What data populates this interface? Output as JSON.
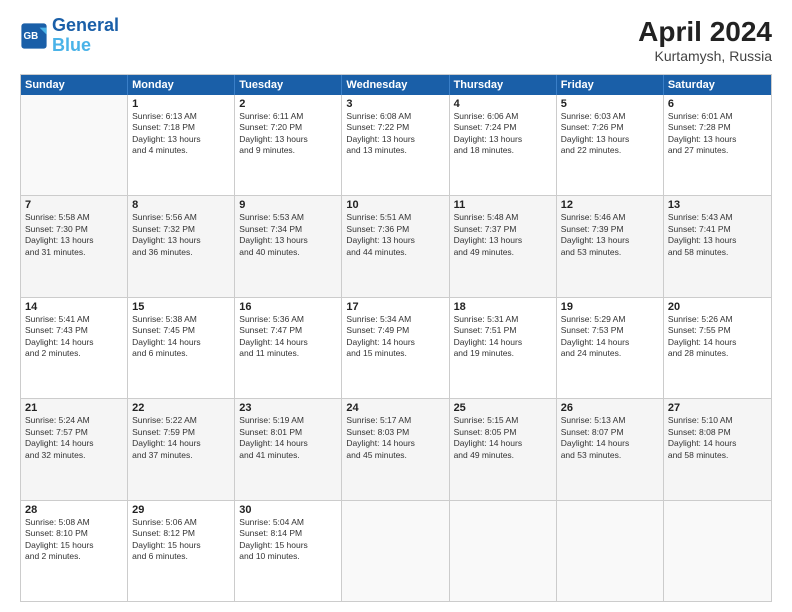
{
  "header": {
    "logo_general": "General",
    "logo_blue": "Blue",
    "month_year": "April 2024",
    "location": "Kurtamysh, Russia"
  },
  "weekdays": [
    "Sunday",
    "Monday",
    "Tuesday",
    "Wednesday",
    "Thursday",
    "Friday",
    "Saturday"
  ],
  "rows": [
    {
      "shade": false,
      "cells": [
        {
          "day": "",
          "lines": []
        },
        {
          "day": "1",
          "lines": [
            "Sunrise: 6:13 AM",
            "Sunset: 7:18 PM",
            "Daylight: 13 hours",
            "and 4 minutes."
          ]
        },
        {
          "day": "2",
          "lines": [
            "Sunrise: 6:11 AM",
            "Sunset: 7:20 PM",
            "Daylight: 13 hours",
            "and 9 minutes."
          ]
        },
        {
          "day": "3",
          "lines": [
            "Sunrise: 6:08 AM",
            "Sunset: 7:22 PM",
            "Daylight: 13 hours",
            "and 13 minutes."
          ]
        },
        {
          "day": "4",
          "lines": [
            "Sunrise: 6:06 AM",
            "Sunset: 7:24 PM",
            "Daylight: 13 hours",
            "and 18 minutes."
          ]
        },
        {
          "day": "5",
          "lines": [
            "Sunrise: 6:03 AM",
            "Sunset: 7:26 PM",
            "Daylight: 13 hours",
            "and 22 minutes."
          ]
        },
        {
          "day": "6",
          "lines": [
            "Sunrise: 6:01 AM",
            "Sunset: 7:28 PM",
            "Daylight: 13 hours",
            "and 27 minutes."
          ]
        }
      ]
    },
    {
      "shade": true,
      "cells": [
        {
          "day": "7",
          "lines": [
            "Sunrise: 5:58 AM",
            "Sunset: 7:30 PM",
            "Daylight: 13 hours",
            "and 31 minutes."
          ]
        },
        {
          "day": "8",
          "lines": [
            "Sunrise: 5:56 AM",
            "Sunset: 7:32 PM",
            "Daylight: 13 hours",
            "and 36 minutes."
          ]
        },
        {
          "day": "9",
          "lines": [
            "Sunrise: 5:53 AM",
            "Sunset: 7:34 PM",
            "Daylight: 13 hours",
            "and 40 minutes."
          ]
        },
        {
          "day": "10",
          "lines": [
            "Sunrise: 5:51 AM",
            "Sunset: 7:36 PM",
            "Daylight: 13 hours",
            "and 44 minutes."
          ]
        },
        {
          "day": "11",
          "lines": [
            "Sunrise: 5:48 AM",
            "Sunset: 7:37 PM",
            "Daylight: 13 hours",
            "and 49 minutes."
          ]
        },
        {
          "day": "12",
          "lines": [
            "Sunrise: 5:46 AM",
            "Sunset: 7:39 PM",
            "Daylight: 13 hours",
            "and 53 minutes."
          ]
        },
        {
          "day": "13",
          "lines": [
            "Sunrise: 5:43 AM",
            "Sunset: 7:41 PM",
            "Daylight: 13 hours",
            "and 58 minutes."
          ]
        }
      ]
    },
    {
      "shade": false,
      "cells": [
        {
          "day": "14",
          "lines": [
            "Sunrise: 5:41 AM",
            "Sunset: 7:43 PM",
            "Daylight: 14 hours",
            "and 2 minutes."
          ]
        },
        {
          "day": "15",
          "lines": [
            "Sunrise: 5:38 AM",
            "Sunset: 7:45 PM",
            "Daylight: 14 hours",
            "and 6 minutes."
          ]
        },
        {
          "day": "16",
          "lines": [
            "Sunrise: 5:36 AM",
            "Sunset: 7:47 PM",
            "Daylight: 14 hours",
            "and 11 minutes."
          ]
        },
        {
          "day": "17",
          "lines": [
            "Sunrise: 5:34 AM",
            "Sunset: 7:49 PM",
            "Daylight: 14 hours",
            "and 15 minutes."
          ]
        },
        {
          "day": "18",
          "lines": [
            "Sunrise: 5:31 AM",
            "Sunset: 7:51 PM",
            "Daylight: 14 hours",
            "and 19 minutes."
          ]
        },
        {
          "day": "19",
          "lines": [
            "Sunrise: 5:29 AM",
            "Sunset: 7:53 PM",
            "Daylight: 14 hours",
            "and 24 minutes."
          ]
        },
        {
          "day": "20",
          "lines": [
            "Sunrise: 5:26 AM",
            "Sunset: 7:55 PM",
            "Daylight: 14 hours",
            "and 28 minutes."
          ]
        }
      ]
    },
    {
      "shade": true,
      "cells": [
        {
          "day": "21",
          "lines": [
            "Sunrise: 5:24 AM",
            "Sunset: 7:57 PM",
            "Daylight: 14 hours",
            "and 32 minutes."
          ]
        },
        {
          "day": "22",
          "lines": [
            "Sunrise: 5:22 AM",
            "Sunset: 7:59 PM",
            "Daylight: 14 hours",
            "and 37 minutes."
          ]
        },
        {
          "day": "23",
          "lines": [
            "Sunrise: 5:19 AM",
            "Sunset: 8:01 PM",
            "Daylight: 14 hours",
            "and 41 minutes."
          ]
        },
        {
          "day": "24",
          "lines": [
            "Sunrise: 5:17 AM",
            "Sunset: 8:03 PM",
            "Daylight: 14 hours",
            "and 45 minutes."
          ]
        },
        {
          "day": "25",
          "lines": [
            "Sunrise: 5:15 AM",
            "Sunset: 8:05 PM",
            "Daylight: 14 hours",
            "and 49 minutes."
          ]
        },
        {
          "day": "26",
          "lines": [
            "Sunrise: 5:13 AM",
            "Sunset: 8:07 PM",
            "Daylight: 14 hours",
            "and 53 minutes."
          ]
        },
        {
          "day": "27",
          "lines": [
            "Sunrise: 5:10 AM",
            "Sunset: 8:08 PM",
            "Daylight: 14 hours",
            "and 58 minutes."
          ]
        }
      ]
    },
    {
      "shade": false,
      "cells": [
        {
          "day": "28",
          "lines": [
            "Sunrise: 5:08 AM",
            "Sunset: 8:10 PM",
            "Daylight: 15 hours",
            "and 2 minutes."
          ]
        },
        {
          "day": "29",
          "lines": [
            "Sunrise: 5:06 AM",
            "Sunset: 8:12 PM",
            "Daylight: 15 hours",
            "and 6 minutes."
          ]
        },
        {
          "day": "30",
          "lines": [
            "Sunrise: 5:04 AM",
            "Sunset: 8:14 PM",
            "Daylight: 15 hours",
            "and 10 minutes."
          ]
        },
        {
          "day": "",
          "lines": []
        },
        {
          "day": "",
          "lines": []
        },
        {
          "day": "",
          "lines": []
        },
        {
          "day": "",
          "lines": []
        }
      ]
    }
  ]
}
